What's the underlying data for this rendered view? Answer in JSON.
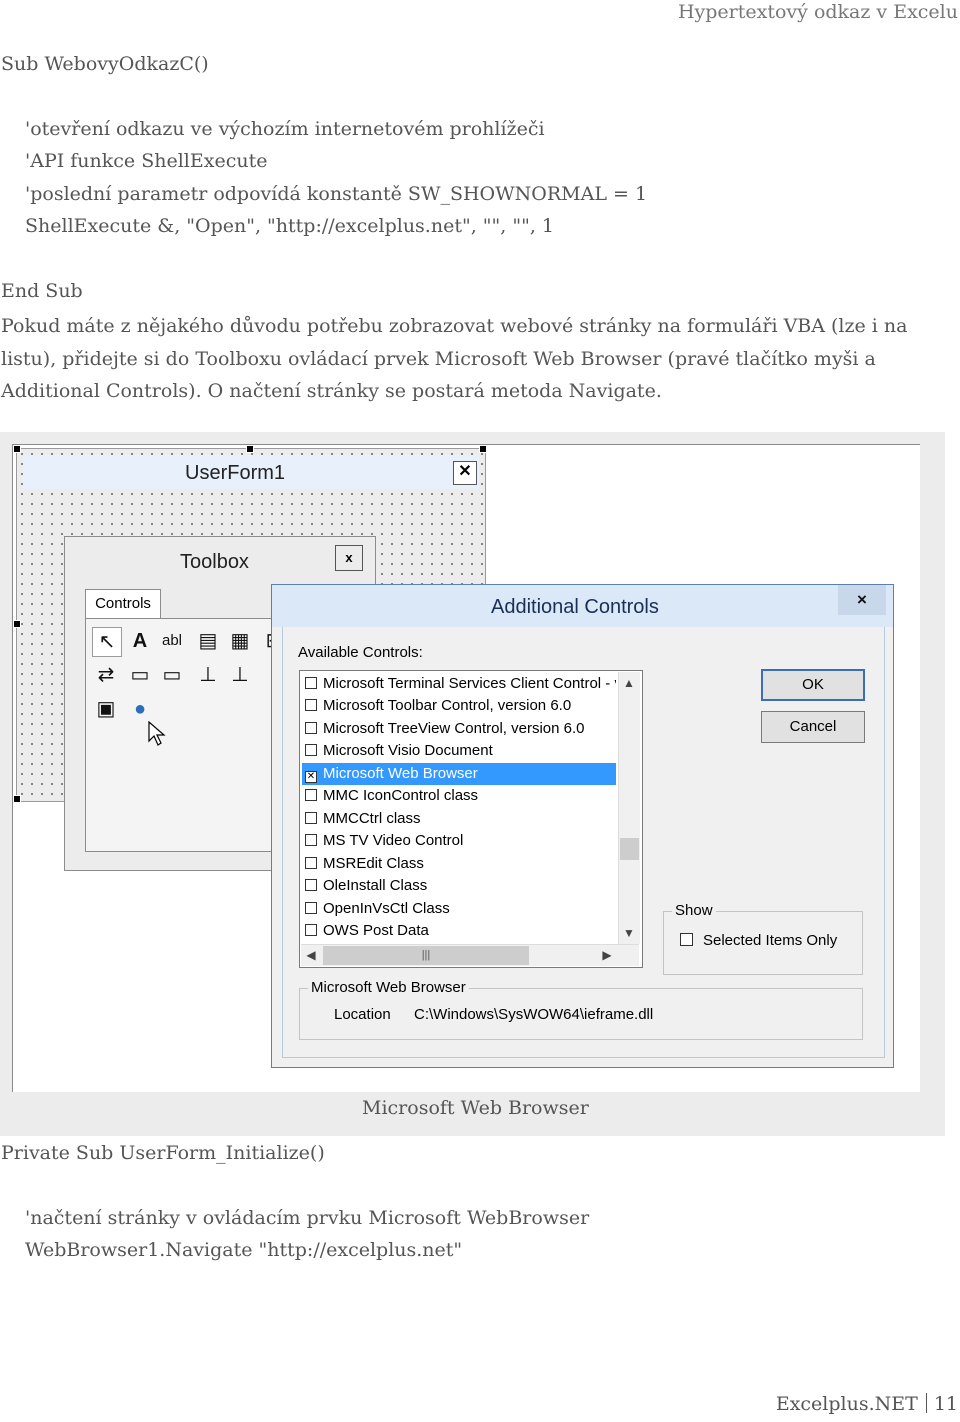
{
  "header": {
    "title": "Hypertextový odkaz v Excelu"
  },
  "code1": {
    "sub_start": "Sub WebovyOdkazC()",
    "lines": [
      "'otevření odkazu ve výchozím internetovém prohlížeči",
      "'API funkce ShellExecute",
      "'poslední parametr odpovídá konstantě SW_SHOWNORMAL = 1",
      "ShellExecute &, \"Open\", \"http://excelplus.net\", \"\", \"\", 1"
    ],
    "sub_end": "End Sub"
  },
  "paragraph": "Pokud máte z nějakého důvodu potřebu zobrazovat webové stránky na formuláři VBA (lze i na listu), přidejte si do Toolboxu ovládací prvek Microsoft Web Browser (pravé tlačítko myši a Additional Controls). O načtení stránky se postará metoda Navigate.",
  "screenshot": {
    "userform_title": "UserForm1",
    "toolbox": {
      "title": "Toolbox",
      "tab": "Controls",
      "close": "x",
      "tools_row1": [
        "↖",
        "A",
        "abl",
        "▤",
        "▦",
        "⊟"
      ],
      "tools_row2": [
        "⇄",
        "▭",
        "▭",
        "⊥",
        "⊥"
      ],
      "tools_row3": [
        "▣",
        "●"
      ]
    },
    "dialog": {
      "title": "Additional Controls",
      "close": "×",
      "available_label": "Available Controls:",
      "items": [
        {
          "label": "Microsoft Terminal Services Client Control - v",
          "checked": false,
          "selected": false
        },
        {
          "label": "Microsoft Toolbar Control, version 6.0",
          "checked": false,
          "selected": false
        },
        {
          "label": "Microsoft TreeView Control, version 6.0",
          "checked": false,
          "selected": false
        },
        {
          "label": "Microsoft Visio Document",
          "checked": false,
          "selected": false
        },
        {
          "label": "Microsoft Web Browser",
          "checked": true,
          "selected": true
        },
        {
          "label": "MMC IconControl class",
          "checked": false,
          "selected": false
        },
        {
          "label": "MMCCtrl class",
          "checked": false,
          "selected": false
        },
        {
          "label": "MS TV Video Control",
          "checked": false,
          "selected": false
        },
        {
          "label": "MSREdit Class",
          "checked": false,
          "selected": false
        },
        {
          "label": "OleInstall Class",
          "checked": false,
          "selected": false
        },
        {
          "label": "OpenInVsCtl Class",
          "checked": false,
          "selected": false
        },
        {
          "label": "OWS Post Data",
          "checked": false,
          "selected": false
        }
      ],
      "ok_label": "OK",
      "cancel_label": "Cancel",
      "show_label": "Show",
      "selected_only_label": "Selected Items Only",
      "info_group_title": "Microsoft Web Browser",
      "location_label": "Location",
      "location_value": "C:\\Windows\\SysWOW64\\ieframe.dll"
    }
  },
  "caption": "Microsoft Web Browser",
  "code2": {
    "sub_start": "Private Sub UserForm_Initialize()",
    "lines": [
      "'načtení stránky v ovládacím prvku Microsoft WebBrowser",
      "WebBrowser1.Navigate \"http://excelplus.net\""
    ]
  },
  "footer": {
    "site": "Excelplus.NET",
    "page": "11"
  }
}
